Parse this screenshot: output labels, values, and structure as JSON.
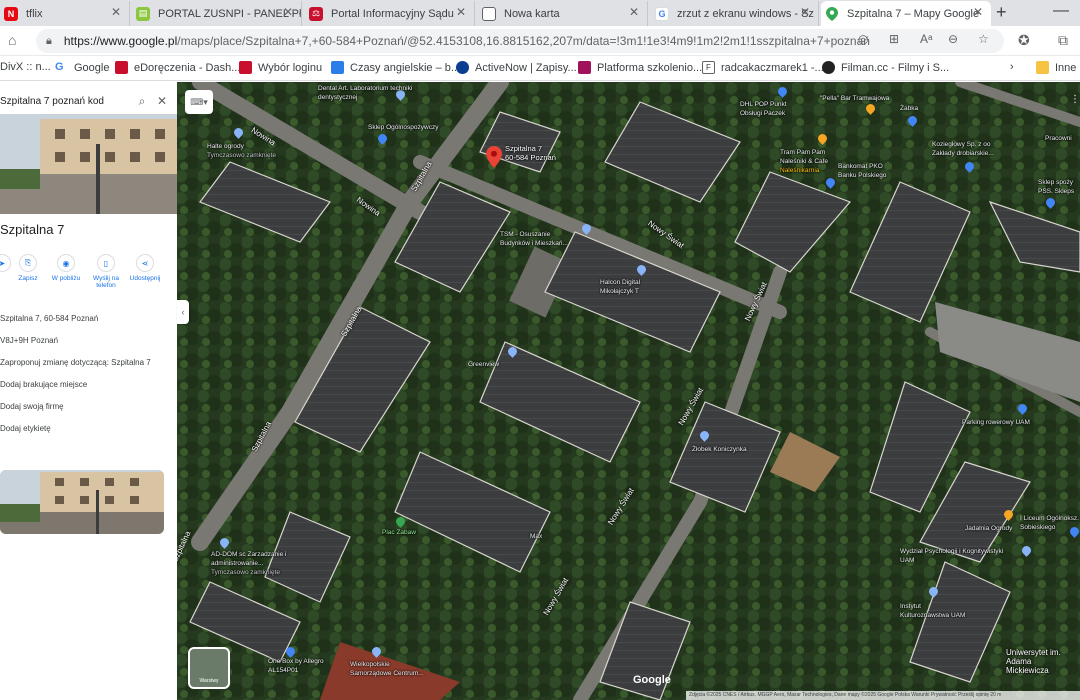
{
  "tabs": [
    {
      "title": "tflix",
      "color": "#e50914",
      "active": false
    },
    {
      "title": "PORTAL ZUSNPI - PANEL Pł",
      "color": "#8cc63f",
      "active": false
    },
    {
      "title": "Portal Informacyjny Sądu",
      "color": "#c8102e",
      "active": false
    },
    {
      "title": "Nowa karta",
      "color": "#5f6368",
      "active": false
    },
    {
      "title": "zrzut z ekranu windows - Sz",
      "color": "#4285f4",
      "active": false
    },
    {
      "title": "Szpitalna 7 – Mapy Google",
      "color": "#34a853",
      "active": true
    }
  ],
  "address": {
    "host": "https://www.google.pl",
    "path": "/maps/place/Szpitalna+7,+60-584+Poznań/@52.4153108,16.8815162,207m/data=!3m1!1e3!4m9!1m2!2m1!1sszpitalna+7+poznań"
  },
  "bookmarks": [
    {
      "label": "DivX :: n...",
      "color": "#1a1a1a"
    },
    {
      "label": "Google",
      "color": "#4285f4"
    },
    {
      "label": "eDoręczenia - Dash...",
      "color": "#c8102e"
    },
    {
      "label": "Wybór loginu",
      "color": "#c8102e"
    },
    {
      "label": "Czasy angielskie – b...",
      "color": "#2b7de9"
    },
    {
      "label": "ActiveNow | Zapisy...",
      "color": "#0b3d91"
    },
    {
      "label": "Platforma szkolenio...",
      "color": "#a0135c"
    },
    {
      "label": "radcakaczmarek1 -...",
      "color": "#ffffff"
    },
    {
      "label": "Filman.cc - Filmy i S...",
      "color": "#222222"
    }
  ],
  "bookmarks_other": "Inne u",
  "panel": {
    "search_query": "Szpitalna 7 poznań kod",
    "place_name": "Szpitalna 7",
    "actions": [
      {
        "label": "",
        "icon": "directions-icon"
      },
      {
        "label": "Zapisz",
        "icon": "bookmark-icon"
      },
      {
        "label": "W pobliżu",
        "icon": "nearby-icon"
      },
      {
        "label": "Wyślij na telefon",
        "icon": "phone-icon"
      },
      {
        "label": "Udostępnij",
        "icon": "share-icon"
      }
    ],
    "info": [
      "Szpitalna 7, 60-584 Poznań",
      "V8J+9H Poznań",
      "Zaproponuj zmianę dotyczącą: Szpitalna 7",
      "Dodaj brakujące miejsce",
      "Dodaj swoją firmę",
      "Dodaj etykietę"
    ]
  },
  "map": {
    "selected_pin_label": "Szpitalna 7\n60-584 Poznań",
    "streets": [
      "Nowina",
      "Nowina",
      "Szpitalna",
      "Szpitalna",
      "Szpitalna",
      "Szpitalna",
      "Nowy Świat",
      "Nowy Świat",
      "Nowy Świat",
      "Nowy Świat",
      "Nowy Świat"
    ],
    "places": [
      {
        "name": "Dental Art. Laboratorium techniki dentystycznej"
      },
      {
        "name": "Sklep Ogólnospożywczy"
      },
      {
        "name": "Halte ogrody",
        "sub": "Tymczasowo zamknięte"
      },
      {
        "name": "TSM - Osuszanie Budynków i Mieszkań..."
      },
      {
        "name": "Halcon Digital Mikołajczyk T"
      },
      {
        "name": "Greenview"
      },
      {
        "name": "Żłobek Koniczynka"
      },
      {
        "name": "DHL POP Punkt Obsługi Paczek"
      },
      {
        "name": "\"Pella\" Bar Tramwajowa"
      },
      {
        "name": "Żabka"
      },
      {
        "name": "Tram Pam Pam Naleśniki & Cafe",
        "sub": "Naleśnikarnia"
      },
      {
        "name": "Bankomat PKO Banku Polskiego"
      },
      {
        "name": "Koziegłowy Sp. z oo Zakłady drobiarskie..."
      },
      {
        "name": "Sklep spoży PSS. Skleps"
      },
      {
        "name": "Pracowni"
      },
      {
        "name": "Parking rowerowy UAM"
      },
      {
        "name": "Jadalnia Ogrody"
      },
      {
        "name": "Wydział Psychologii i Kognitywistyki UAM"
      },
      {
        "name": "Instytut Kulturoznawstwa UAM"
      },
      {
        "name": "Uniwersytet im. Adama Mickiewicza"
      },
      {
        "name": "I Liceum Ogólnoksz. Sobieskiego"
      },
      {
        "name": "Plac Zabaw"
      },
      {
        "name": "Max"
      },
      {
        "name": "AD-DOM sc Zarzadzanie i administrowanie...",
        "sub": "Tymczasowo zamknięte"
      },
      {
        "name": "One Box by Allegro AL154P01"
      },
      {
        "name": "Wielkopolskie Samorządowe Centrum..."
      }
    ],
    "layers_label": "Warstwy",
    "google_logo": "Google",
    "attribution": "Zdjęcia ©2025 CNES / Airbus, MGGP Aero, Maxar Technologies, Dane mapy ©2025 Google   Polska   Warunki   Prywatność   Prześlij opinię   20 m"
  }
}
